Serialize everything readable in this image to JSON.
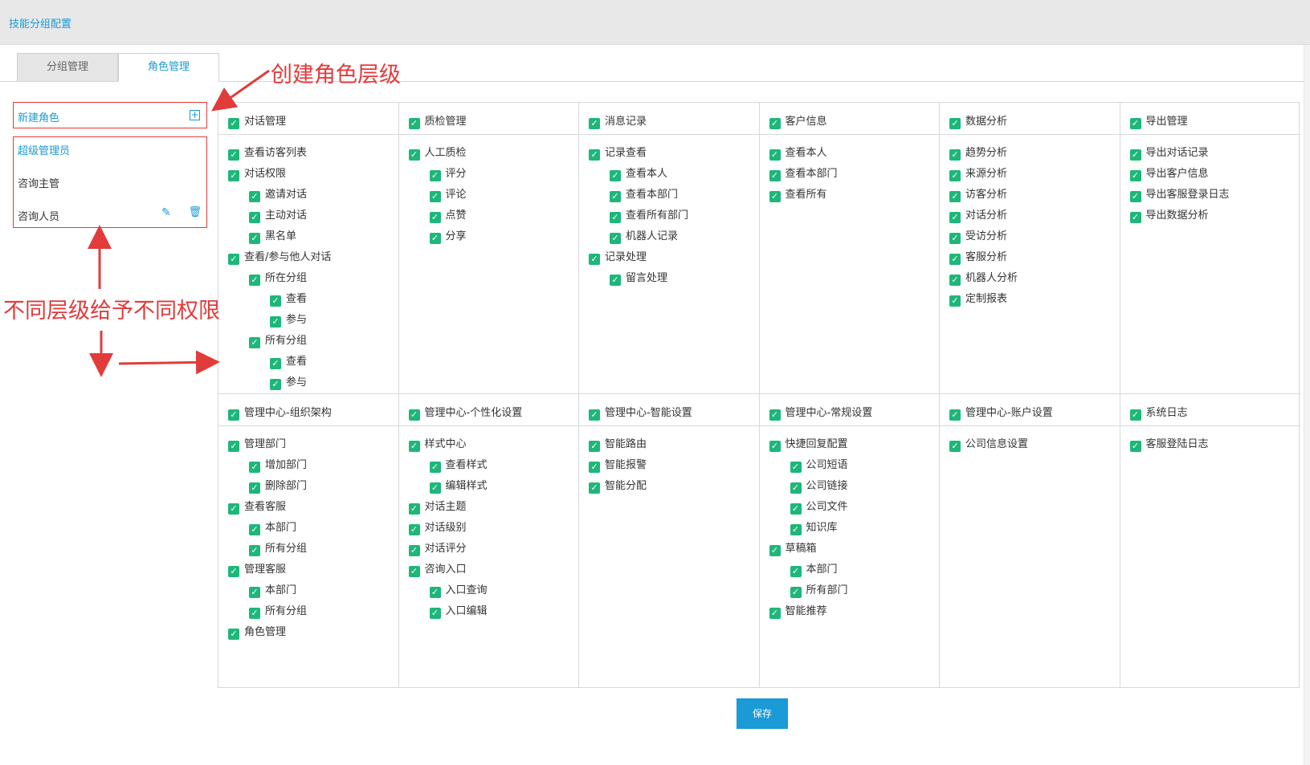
{
  "page": {
    "title": "技能分组配置"
  },
  "tabs": [
    {
      "label": "分组管理"
    },
    {
      "label": "角色管理"
    }
  ],
  "roles": {
    "new_label": "新建角色",
    "items": [
      {
        "label": "超级管理员"
      },
      {
        "label": "咨询主管"
      },
      {
        "label": "咨询人员"
      }
    ]
  },
  "permissions": {
    "row1": [
      {
        "header": "对话管理",
        "items": [
          {
            "label": "查看访客列表",
            "level": 0
          },
          {
            "label": "对话权限",
            "level": 0
          },
          {
            "label": "邀请对话",
            "level": 1
          },
          {
            "label": "主动对话",
            "level": 1
          },
          {
            "label": "黑名单",
            "level": 1
          },
          {
            "label": "查看/参与他人对话",
            "level": 0
          },
          {
            "label": "所在分组",
            "level": 1
          },
          {
            "label": "查看",
            "level": 2
          },
          {
            "label": "参与",
            "level": 2
          },
          {
            "label": "所有分组",
            "level": 1
          },
          {
            "label": "查看",
            "level": 2
          },
          {
            "label": "参与",
            "level": 2
          }
        ]
      },
      {
        "header": "质检管理",
        "items": [
          {
            "label": "人工质检",
            "level": 0
          },
          {
            "label": "评分",
            "level": 1
          },
          {
            "label": "评论",
            "level": 1
          },
          {
            "label": "点赞",
            "level": 1
          },
          {
            "label": "分享",
            "level": 1
          }
        ]
      },
      {
        "header": "消息记录",
        "items": [
          {
            "label": "记录查看",
            "level": 0
          },
          {
            "label": "查看本人",
            "level": 1
          },
          {
            "label": "查看本部门",
            "level": 1
          },
          {
            "label": "查看所有部门",
            "level": 1
          },
          {
            "label": "机器人记录",
            "level": 1
          },
          {
            "label": "记录处理",
            "level": 0
          },
          {
            "label": "留言处理",
            "level": 1
          }
        ]
      },
      {
        "header": "客户信息",
        "items": [
          {
            "label": "查看本人",
            "level": 0
          },
          {
            "label": "查看本部门",
            "level": 0
          },
          {
            "label": "查看所有",
            "level": 0
          }
        ]
      },
      {
        "header": "数据分析",
        "items": [
          {
            "label": "趋势分析",
            "level": 0
          },
          {
            "label": "来源分析",
            "level": 0
          },
          {
            "label": "访客分析",
            "level": 0
          },
          {
            "label": "对话分析",
            "level": 0
          },
          {
            "label": "受访分析",
            "level": 0
          },
          {
            "label": "客服分析",
            "level": 0
          },
          {
            "label": "机器人分析",
            "level": 0
          },
          {
            "label": "定制报表",
            "level": 0
          }
        ]
      },
      {
        "header": "导出管理",
        "items": [
          {
            "label": "导出对话记录",
            "level": 0
          },
          {
            "label": "导出客户信息",
            "level": 0
          },
          {
            "label": "导出客服登录日志",
            "level": 0
          },
          {
            "label": "导出数据分析",
            "level": 0
          }
        ]
      }
    ],
    "row2": [
      {
        "header": "管理中心-组织架构",
        "items": [
          {
            "label": "管理部门",
            "level": 0
          },
          {
            "label": "增加部门",
            "level": 1
          },
          {
            "label": "删除部门",
            "level": 1
          },
          {
            "label": "查看客服",
            "level": 0
          },
          {
            "label": "本部门",
            "level": 1
          },
          {
            "label": "所有分组",
            "level": 1
          },
          {
            "label": "管理客服",
            "level": 0
          },
          {
            "label": "本部门",
            "level": 1
          },
          {
            "label": "所有分组",
            "level": 1
          },
          {
            "label": "角色管理",
            "level": 0
          }
        ]
      },
      {
        "header": "管理中心-个性化设置",
        "items": [
          {
            "label": "样式中心",
            "level": 0
          },
          {
            "label": "查看样式",
            "level": 1
          },
          {
            "label": "编辑样式",
            "level": 1
          },
          {
            "label": "对话主题",
            "level": 0
          },
          {
            "label": "对话级别",
            "level": 0
          },
          {
            "label": "对话评分",
            "level": 0
          },
          {
            "label": "咨询入口",
            "level": 0
          },
          {
            "label": "入口查询",
            "level": 1
          },
          {
            "label": "入口编辑",
            "level": 1
          }
        ]
      },
      {
        "header": "管理中心-智能设置",
        "items": [
          {
            "label": "智能路由",
            "level": 0
          },
          {
            "label": "智能报警",
            "level": 0
          },
          {
            "label": "智能分配",
            "level": 0
          }
        ]
      },
      {
        "header": "管理中心-常规设置",
        "items": [
          {
            "label": "快捷回复配置",
            "level": 0
          },
          {
            "label": "公司短语",
            "level": 1
          },
          {
            "label": "公司链接",
            "level": 1
          },
          {
            "label": "公司文件",
            "level": 1
          },
          {
            "label": "知识库",
            "level": 1
          },
          {
            "label": "草稿箱",
            "level": 0
          },
          {
            "label": "本部门",
            "level": 1
          },
          {
            "label": "所有部门",
            "level": 1
          },
          {
            "label": "智能推荐",
            "level": 0
          }
        ]
      },
      {
        "header": "管理中心-账户设置",
        "items": [
          {
            "label": "公司信息设置",
            "level": 0
          }
        ]
      },
      {
        "header": "系统日志",
        "items": [
          {
            "label": "客服登陆日志",
            "level": 0
          }
        ]
      }
    ]
  },
  "save_label": "保存",
  "annotations": {
    "create_role_level": "创建角色层级",
    "different_permissions": "不同层级给予不同权限"
  },
  "colors": {
    "accent": "#1a9ad6",
    "check": "#1db77a",
    "annotation": "#e23b3b"
  }
}
